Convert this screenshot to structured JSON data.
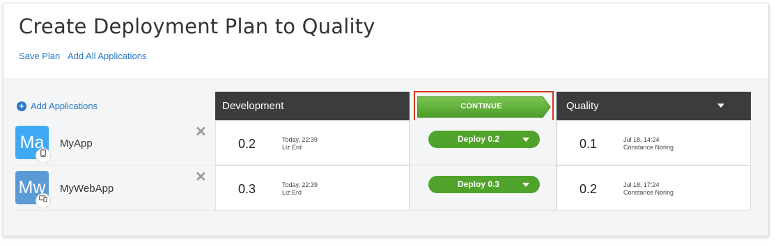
{
  "header": {
    "title": "Create Deployment Plan to Quality",
    "save_plan": "Save Plan",
    "add_all_applications": "Add All Applications"
  },
  "sidebar": {
    "add_applications": "Add Applications"
  },
  "environments": {
    "source": "Development",
    "target": "Quality",
    "continue_label": "CONTINUE"
  },
  "apps": [
    {
      "icon_text": "Ma",
      "name": "MyApp",
      "platform_icon": "mobile-icon",
      "dev_version": "0.2",
      "dev_time": "Today, 22:39",
      "dev_user": "Liz Erd",
      "deploy_label": "Deploy 0.2",
      "qa_version": "0.1",
      "qa_time": "Jul 18, 14:24",
      "qa_user": "Constance Noring"
    },
    {
      "icon_text": "Mw",
      "name": "MyWebApp",
      "platform_icon": "responsive-devices-icon",
      "dev_version": "0.3",
      "dev_time": "Today, 22:39",
      "dev_user": "Liz Erd",
      "deploy_label": "Deploy 0.3",
      "qa_version": "0.2",
      "qa_time": "Jul 18, 17:24",
      "qa_user": "Constance Noring"
    }
  ],
  "colors": {
    "link": "#2a7ac7",
    "deploy_green": "#4fa32a",
    "header_dark": "#3b3c3e",
    "highlight_red": "#d0361c"
  }
}
